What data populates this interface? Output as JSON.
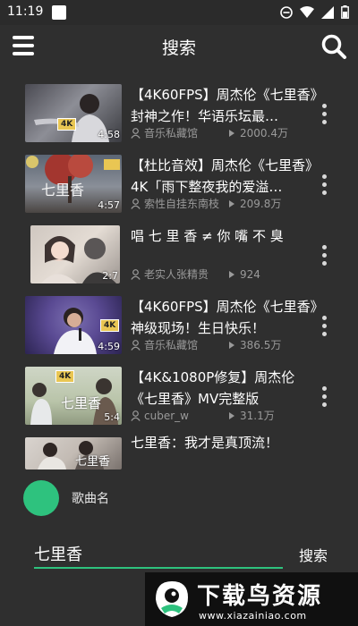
{
  "status": {
    "time": "11:19"
  },
  "header": {
    "title": "搜索",
    "menu_icon": "menu-icon",
    "search_icon": "search-icon"
  },
  "results": [
    {
      "title": "【4K60FPS】周杰伦《七里香》封神之作！华语乐坛最…",
      "author": "音乐私藏馆",
      "views": "2000.4万",
      "duration": "4:58",
      "badge": "4K"
    },
    {
      "title": "【杜比音效】周杰伦《七里香》4K「雨下整夜我的爱溢…",
      "author": "索性自挂东南枝",
      "views": "209.8万",
      "duration": "4:57",
      "thumb_text": "七里香"
    },
    {
      "title": "唱 七 里 香 ≠ 你 嘴 不 臭",
      "author": "老实人张精贵",
      "views": "924",
      "duration": "2:7"
    },
    {
      "title": "【4K60FPS】周杰伦《七里香》神级现场！生日快乐！",
      "author": "音乐私藏馆",
      "views": "386.5万",
      "duration": "4:59",
      "badge": "4K"
    },
    {
      "title": "【4K&1080P修复】周杰伦《七里香》MV完整版",
      "author": "cuber_w",
      "views": "31.1万",
      "duration": "5:4",
      "badge": "4K",
      "thumb_text": "七里香"
    },
    {
      "title": "七里香：我才是真顶流！",
      "thumb_text": "七里香"
    }
  ],
  "now_playing": {
    "label": "歌曲名",
    "color": "#2ec27e"
  },
  "search": {
    "value": "七里香",
    "button_label": "搜索"
  },
  "watermark": {
    "text": "下载鸟资源",
    "url": "www.xiazainiao.com"
  },
  "colors": {
    "background": "#2f2f2f",
    "accent": "#2ec27e"
  }
}
